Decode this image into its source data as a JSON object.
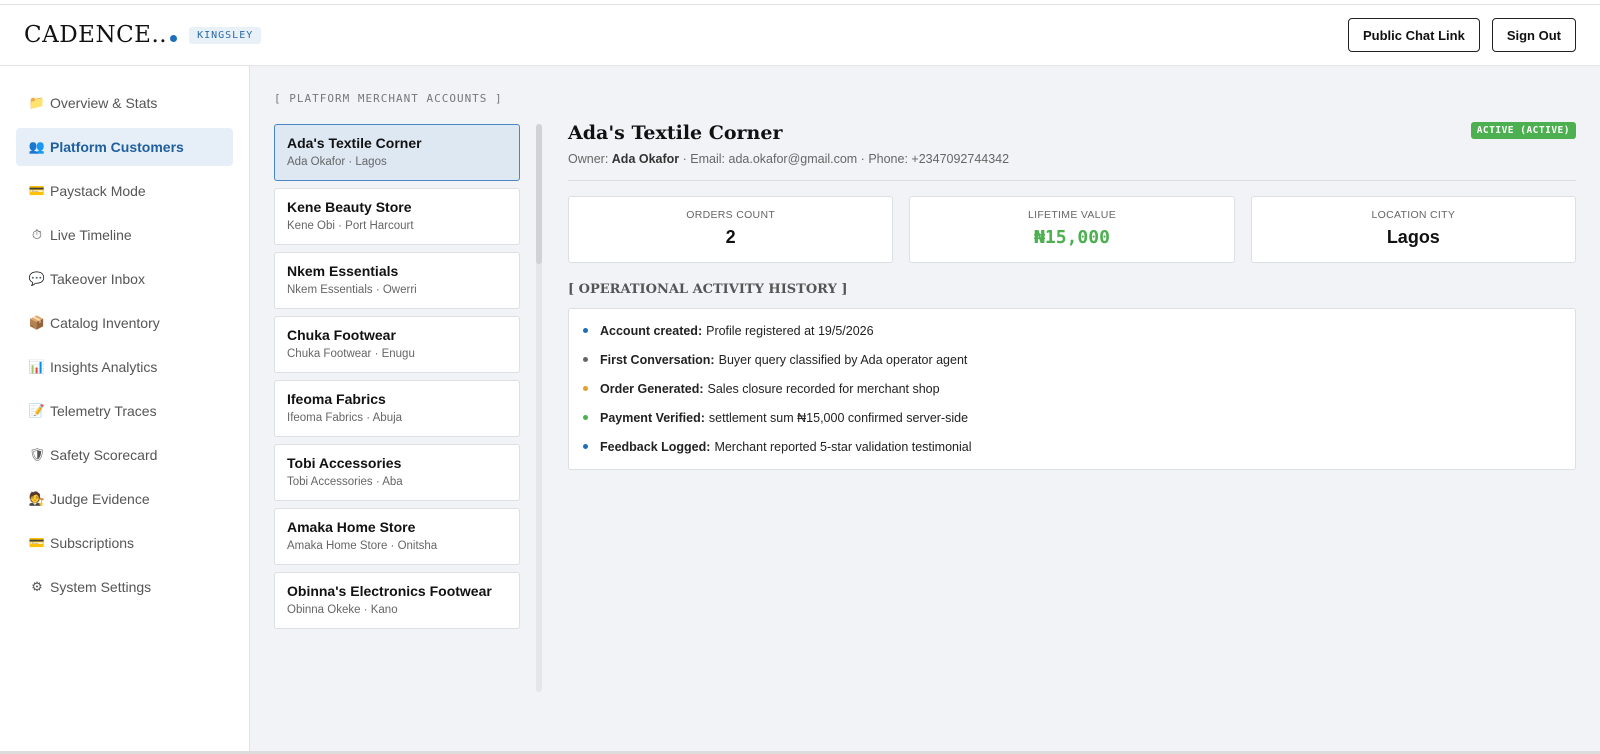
{
  "header": {
    "logo": "CADENCE..",
    "workspace": "KINGSLEY",
    "public_chat_label": "Public Chat Link",
    "sign_out_label": "Sign Out"
  },
  "sidebar": {
    "items": [
      {
        "icon": "folder-icon",
        "glyph": "📁",
        "label": "Overview & Stats"
      },
      {
        "icon": "users-icon",
        "glyph": "👥",
        "label": "Platform Customers",
        "active": true
      },
      {
        "icon": "credit-card-icon",
        "glyph": "💳",
        "label": "Paystack Mode"
      },
      {
        "icon": "stopwatch-icon",
        "glyph": "⏱",
        "label": "Live Timeline"
      },
      {
        "icon": "chat-icon",
        "glyph": "💬",
        "label": "Takeover Inbox"
      },
      {
        "icon": "package-icon",
        "glyph": "📦",
        "label": "Catalog Inventory"
      },
      {
        "icon": "bar-chart-icon",
        "glyph": "📊",
        "label": "Insights Analytics"
      },
      {
        "icon": "memo-icon",
        "glyph": "📝",
        "label": "Telemetry Traces"
      },
      {
        "icon": "shield-icon",
        "glyph": "🛡",
        "label": "Safety Scorecard"
      },
      {
        "icon": "judge-icon",
        "glyph": "🧑‍⚖️",
        "label": "Judge Evidence"
      },
      {
        "icon": "credit-card-icon",
        "glyph": "💳",
        "label": "Subscriptions"
      },
      {
        "icon": "gear-icon",
        "glyph": "⚙",
        "label": "System Settings"
      }
    ]
  },
  "merchants": {
    "section_label": "[ PLATFORM MERCHANT ACCOUNTS ]",
    "items": [
      {
        "name": "Ada's Textile Corner",
        "sub": "Ada Okafor · Lagos",
        "selected": true
      },
      {
        "name": "Kene Beauty Store",
        "sub": "Kene Obi · Port Harcourt"
      },
      {
        "name": "Nkem Essentials",
        "sub": "Nkem Essentials · Owerri"
      },
      {
        "name": "Chuka Footwear",
        "sub": "Chuka Footwear · Enugu"
      },
      {
        "name": "Ifeoma Fabrics",
        "sub": "Ifeoma Fabrics · Abuja"
      },
      {
        "name": "Tobi Accessories",
        "sub": "Tobi Accessories · Aba"
      },
      {
        "name": "Amaka Home Store",
        "sub": "Amaka Home Store · Onitsha"
      },
      {
        "name": "Obinna's Electronics Footwear",
        "sub": "Obinna Okeke · Kano"
      }
    ]
  },
  "detail": {
    "title": "Ada's Textile Corner",
    "status": "ACTIVE (ACTIVE)",
    "owner_prefix": "Owner:",
    "owner_name": "Ada Okafor",
    "contact": "· Email: ada.okafor@gmail.com · Phone: +2347092744342",
    "stats": [
      {
        "label": "ORDERS COUNT",
        "value": "2"
      },
      {
        "label": "LIFETIME VALUE",
        "value": "₦15,000"
      },
      {
        "label": "LOCATION CITY",
        "value": "Lagos"
      }
    ],
    "history_title": "[ OPERATIONAL ACTIVITY HISTORY ]",
    "history": [
      {
        "label": "Account created:",
        "text": "Profile registered at 19/5/2026",
        "color": "#1f6fb8"
      },
      {
        "label": "First Conversation:",
        "text": "Buyer query classified by Ada operator agent",
        "color": "#666666"
      },
      {
        "label": "Order Generated:",
        "text": "Sales closure recorded for merchant shop",
        "color": "#e0a030"
      },
      {
        "label": "Payment Verified:",
        "text": "settlement sum ₦15,000 confirmed server-side",
        "color": "#4caf50"
      },
      {
        "label": "Feedback Logged:",
        "text": "Merchant reported 5-star validation testimonial",
        "color": "#1f6fb8"
      }
    ]
  },
  "colors": {
    "accent": "#1f6fb8",
    "success": "#4caf50"
  }
}
